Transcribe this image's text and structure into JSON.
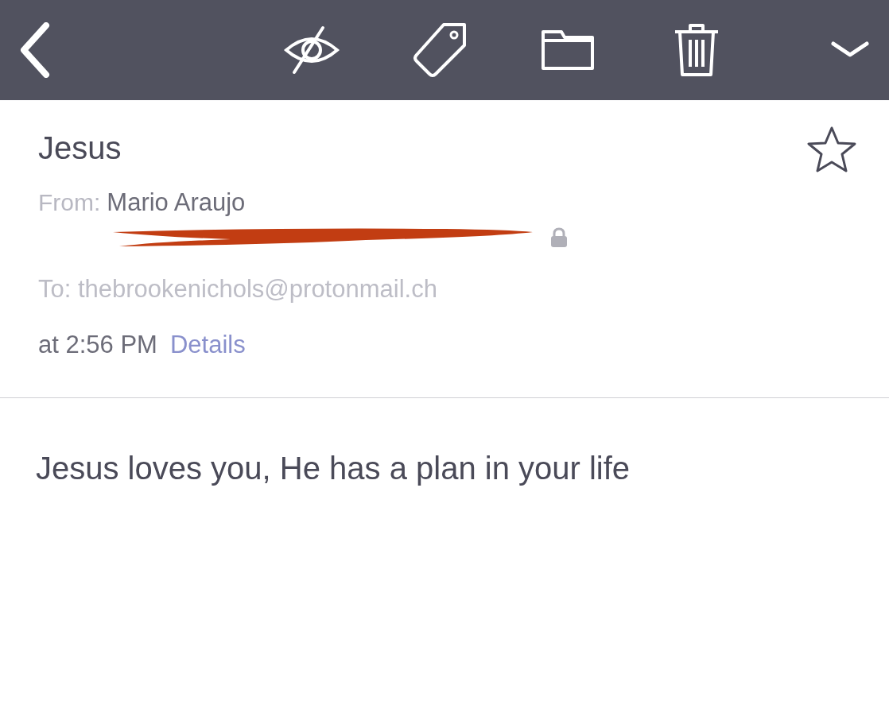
{
  "message": {
    "subject": "Jesus",
    "starred": false,
    "from_label": "From:",
    "sender": "Mario Araujo",
    "to": "To: thebrookenichols@protonmail.ch",
    "time": "at 2:56 PM",
    "details_link": "Details",
    "body": "Jesus loves you, He has a plan in your life"
  }
}
